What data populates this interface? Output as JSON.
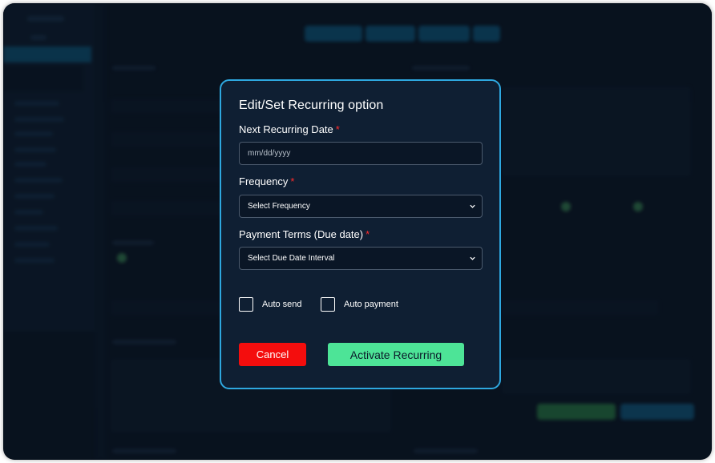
{
  "modal": {
    "title": "Edit/Set Recurring option",
    "required_marker": "*",
    "next_date": {
      "label": "Next Recurring Date",
      "placeholder": "mm/dd/yyyy"
    },
    "frequency": {
      "label": "Frequency",
      "selected": "Select Frequency"
    },
    "payment_terms": {
      "label": "Payment Terms (Due date)",
      "selected": "Select Due Date Interval"
    },
    "checkboxes": {
      "auto_send": {
        "label": "Auto send",
        "checked": false
      },
      "auto_payment": {
        "label": "Auto payment",
        "checked": false
      }
    },
    "buttons": {
      "cancel": "Cancel",
      "activate": "Activate Recurring"
    }
  },
  "colors": {
    "modal_border": "#2ea8e0",
    "modal_bg": "#0f1f33",
    "required": "#ff2b2b",
    "cancel_bg": "#f40d0d",
    "activate_bg": "#4de497"
  },
  "icons": {
    "select_arrow": "chevron-down-icon"
  }
}
